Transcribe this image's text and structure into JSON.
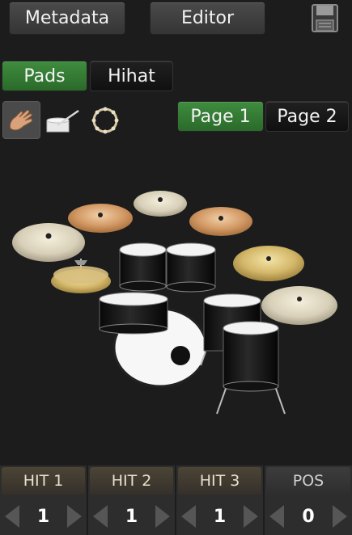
{
  "header": {
    "metadata_label": "Metadata",
    "editor_label": "Editor",
    "save_icon": "floppy-disk-icon"
  },
  "tabs": {
    "pads_label": "Pads",
    "hihat_label": "Hihat",
    "active": "Pads"
  },
  "tools": [
    {
      "icon": "hand-icon",
      "active": true
    },
    {
      "icon": "drumstick-icon",
      "active": false
    },
    {
      "icon": "tambourine-icon",
      "active": false
    }
  ],
  "pages": {
    "page1_label": "Page 1",
    "page2_label": "Page 2",
    "active": "Page 1"
  },
  "footer": {
    "hit1": {
      "label": "HIT 1",
      "value": "1"
    },
    "hit2": {
      "label": "HIT 2",
      "value": "1"
    },
    "hit3": {
      "label": "HIT 3",
      "value": "1"
    },
    "pos": {
      "label": "POS",
      "value": "0"
    }
  },
  "colors": {
    "active_green": "#2e7d32",
    "background": "#1c1c1c"
  }
}
